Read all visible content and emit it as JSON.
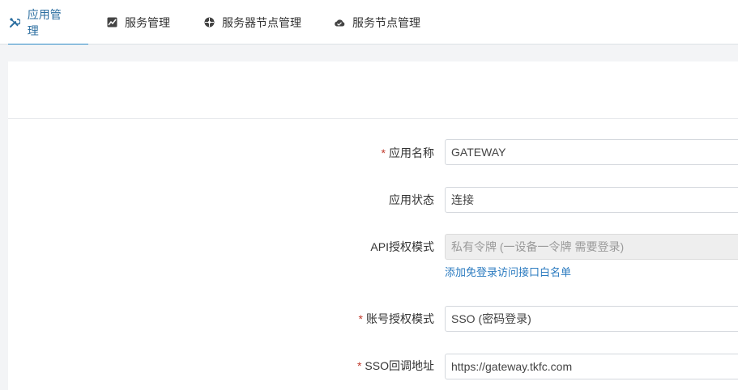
{
  "tabs": [
    {
      "label": "应用管理",
      "icon": "tools-icon",
      "active": true
    },
    {
      "label": "服务管理",
      "icon": "chart-icon",
      "active": false
    },
    {
      "label": "服务器节点管理",
      "icon": "network-icon",
      "active": false
    },
    {
      "label": "服务节点管理",
      "icon": "cloud-icon",
      "active": false
    }
  ],
  "colors": {
    "accent": "#2b8ac6",
    "required": "#c0392b",
    "link": "#2b7bc0"
  },
  "form": {
    "app_name": {
      "label": "应用名称",
      "required": true,
      "value": "GATEWAY"
    },
    "app_status": {
      "label": "应用状态",
      "required": false,
      "value": "连接"
    },
    "api_auth_mode": {
      "label": "API授权模式",
      "required": false,
      "value": "私有令牌 (一设备一令牌 需要登录)",
      "disabled": true
    },
    "whitelist_link": "添加免登录访问接口白名单",
    "account_auth_mode": {
      "label": "账号授权模式",
      "required": true,
      "value": "SSO (密码登录)"
    },
    "sso_callback": {
      "label": "SSO回调地址",
      "required": true,
      "value": "https://gateway.tkfc.com"
    }
  }
}
